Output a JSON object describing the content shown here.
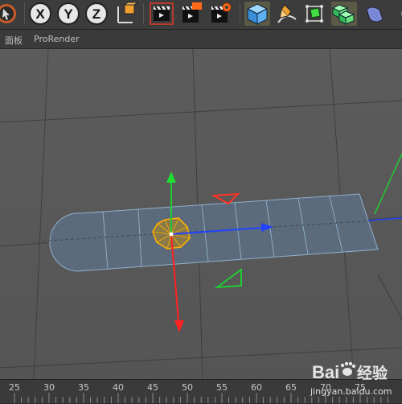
{
  "menubar": {
    "items": [
      "面板",
      "ProRender"
    ]
  },
  "toolbar": {
    "x_label": "X",
    "y_label": "Y",
    "z_label": "Z"
  },
  "timeline": {
    "ticks": [
      "25",
      "30",
      "35",
      "40",
      "45",
      "50",
      "55",
      "60",
      "65",
      "70",
      "75"
    ]
  },
  "watermark": {
    "logo_text": "Bai",
    "logo_text_2": "经验",
    "url": "jingyan.baidu.com"
  },
  "colors": {
    "viewport_bg": "#5a5a5a",
    "mesh_fill": "#5b6b7e",
    "mesh_edge": "#8aa8c4",
    "selection": "#ffb000",
    "axis_x": "#2244ff",
    "axis_y": "#22cc33",
    "axis_z": "#ff2222"
  }
}
